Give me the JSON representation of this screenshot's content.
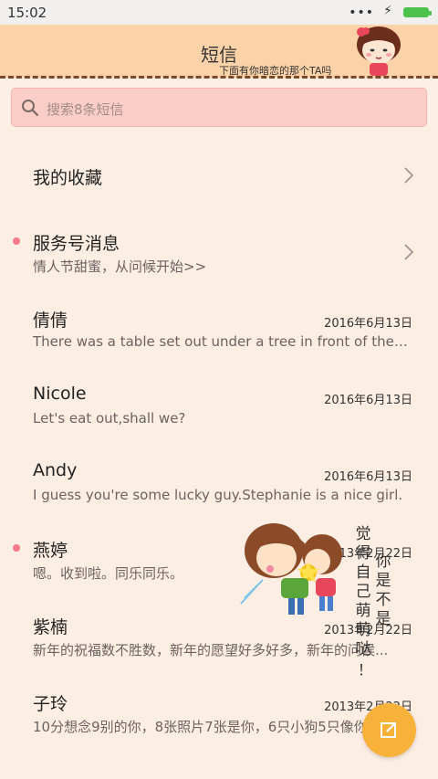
{
  "status_bar": {
    "time": "15:02",
    "dots": "•••",
    "bolt": "⚡"
  },
  "header": {
    "title": "短信",
    "subtitle": "下面有你暗恋的那个TA吗"
  },
  "search": {
    "placeholder": "搜索8条短信"
  },
  "favorites": {
    "title": "我的收藏"
  },
  "service": {
    "title": "服务号消息",
    "subtitle": "情人节甜蜜，从问候开始>>"
  },
  "conversations": [
    {
      "name": "倩倩",
      "date": "2016年6月13日",
      "preview": "There was a table set out under a tree in front of the ho...",
      "unread": false
    },
    {
      "name": "Nicole",
      "date": "2016年6月13日",
      "preview": "Let's eat out,shall we?",
      "unread": false
    },
    {
      "name": "Andy",
      "date": "2016年6月13日",
      "preview": "I guess you're some lucky guy.Stephanie is a nice girl.",
      "unread": false
    },
    {
      "name": "燕婷",
      "date": "2013年2月22日",
      "preview": "嗯。收到啦。同乐同乐。",
      "unread": true
    },
    {
      "name": "紫楠",
      "date": "2013年2月22日",
      "preview": "新年的祝福数不胜数，新年的愿望好多好多，新年的问候...",
      "unread": false
    },
    {
      "name": "子玲",
      "date": "2013年2月22日",
      "preview": "10分想念9别的你，8张照片7张是你，6只小狗5只像你",
      "unread": false
    }
  ],
  "decoration": {
    "text_col1": "觉得自己萌萌哒",
    "text_col2": "你是不是",
    "exclaim": "！"
  },
  "colors": {
    "header_bg": "#fcd2a8",
    "page_bg": "#fdeee3",
    "search_bg": "#facdc6",
    "fab": "#f8b23a",
    "unread_dot": "#f37a8d"
  },
  "icons": {
    "search": "search-icon",
    "chevron": "chevron-right-icon",
    "compose": "compose-icon"
  }
}
